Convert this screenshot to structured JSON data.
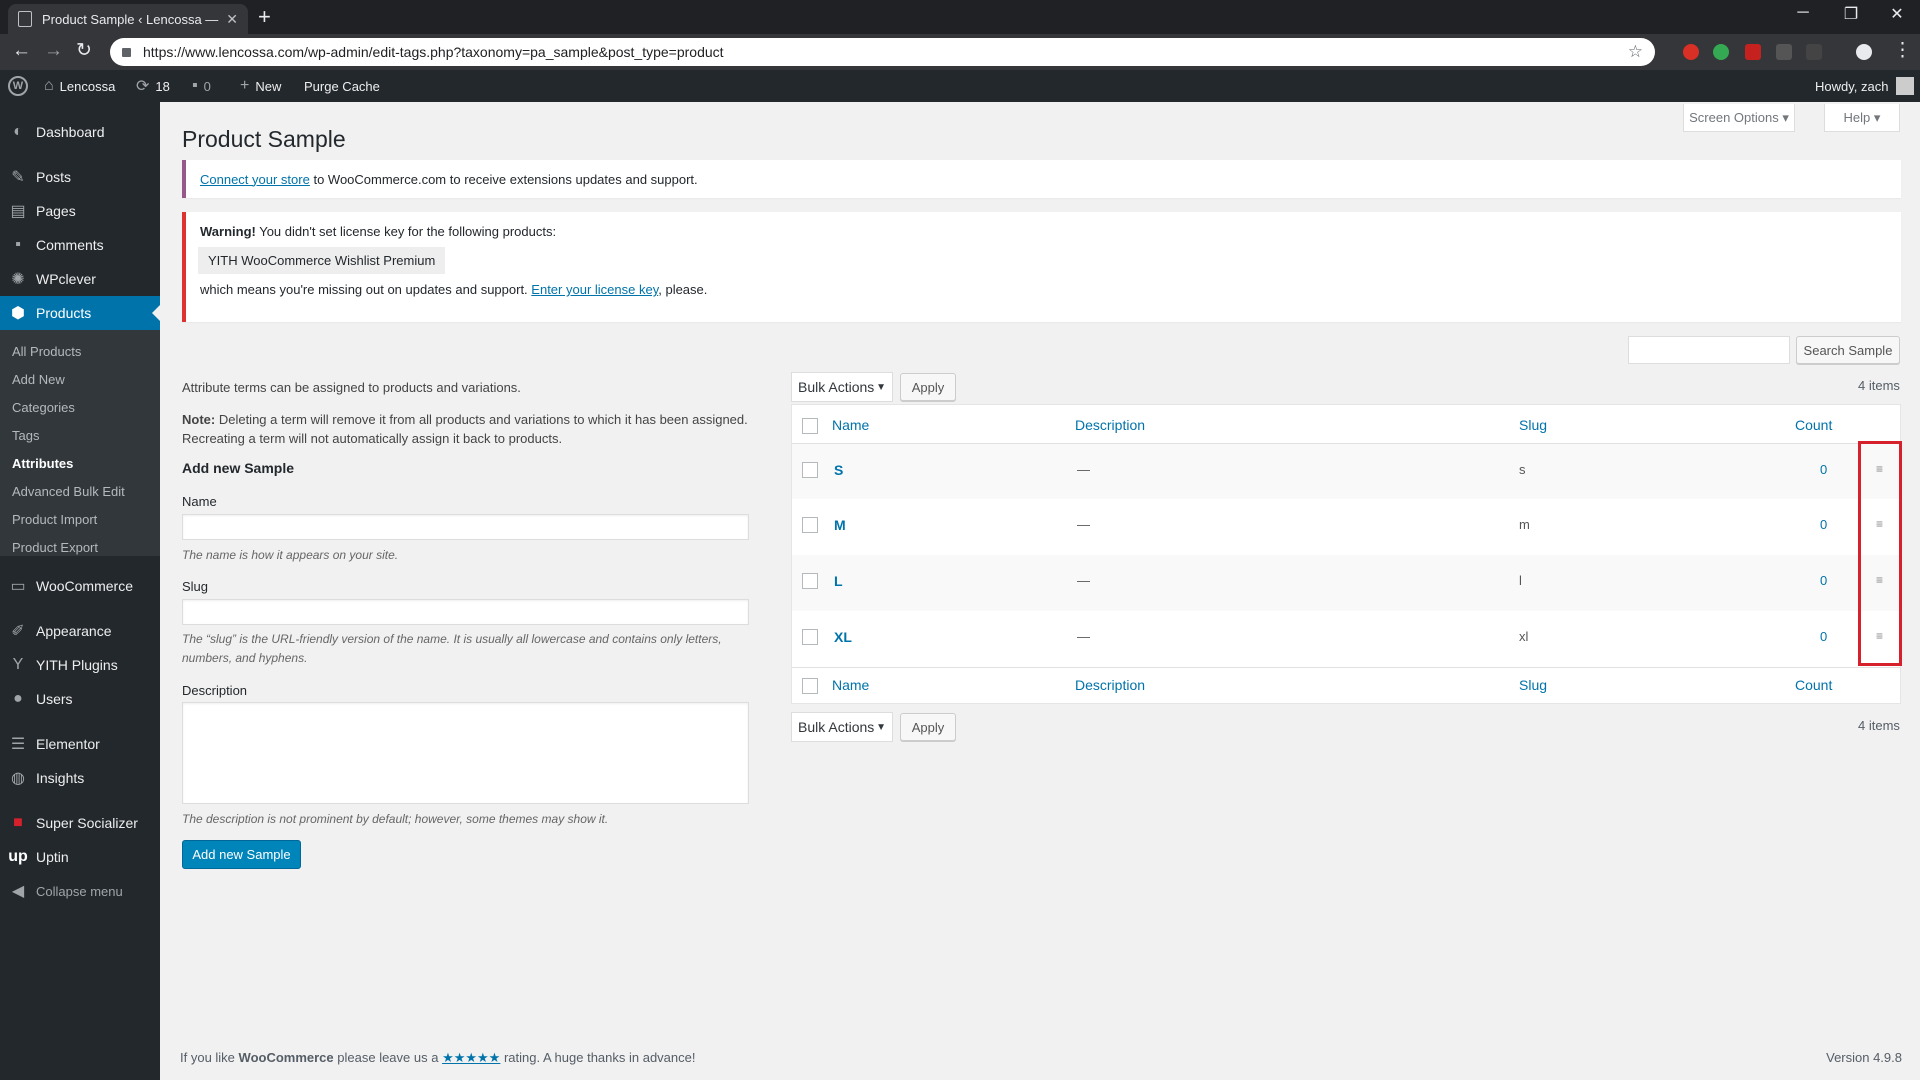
{
  "browser": {
    "tab_title": "Product Sample ‹ Lencossa — W",
    "url": "https://www.lencossa.com/wp-admin/edit-tags.php?taxonomy=pa_sample&post_type=product"
  },
  "adminbar": {
    "site_name": "Lencossa",
    "updates_count": "18",
    "comments_count": "0",
    "new_label": "New",
    "purge_label": "Purge Cache",
    "howdy": "Howdy, zach"
  },
  "sidebar": {
    "items": [
      {
        "label": "Dashboard",
        "icon": "dashboard-icon"
      },
      {
        "label": "Posts",
        "icon": "pin-icon"
      },
      {
        "label": "Pages",
        "icon": "pages-icon"
      },
      {
        "label": "Comments",
        "icon": "comment-icon"
      },
      {
        "label": "WPclever",
        "icon": "gear-icon"
      },
      {
        "label": "Products",
        "icon": "product-icon"
      },
      {
        "label": "WooCommerce",
        "icon": "woo-icon"
      },
      {
        "label": "Appearance",
        "icon": "brush-icon"
      },
      {
        "label": "YITH Plugins",
        "icon": "yith-icon"
      },
      {
        "label": "Users",
        "icon": "user-icon"
      },
      {
        "label": "Elementor",
        "icon": "elementor-icon"
      },
      {
        "label": "Insights",
        "icon": "insights-icon"
      },
      {
        "label": "Super Socializer",
        "icon": "socializer-icon"
      },
      {
        "label": "Uptin",
        "icon": "uptin-icon"
      },
      {
        "label": "Collapse menu",
        "icon": "collapse-icon"
      }
    ],
    "submenu": [
      "All Products",
      "Add New",
      "Categories",
      "Tags",
      "Attributes",
      "Advanced Bulk Edit",
      "Product Import",
      "Product Export"
    ]
  },
  "header": {
    "screen_options": "Screen Options",
    "help": "Help",
    "title": "Product Sample"
  },
  "notices": {
    "connect_link": "Connect your store",
    "connect_text": " to WooCommerce.com to receive extensions updates and support.",
    "warning_bold": "Warning!",
    "warning_text": " You didn't set license key for the following products:",
    "product": "YITH WooCommerce Wishlist Premium",
    "missing_text": "which means you're missing out on updates and support. ",
    "license_link": "Enter your license key",
    "please": ", please."
  },
  "search": {
    "button": "Search Sample"
  },
  "form": {
    "intro": "Attribute terms can be assigned to products and variations.",
    "note_bold": "Note:",
    "note_text": " Deleting a term will remove it from all products and variations to which it has been assigned. Recreating a term will not automatically assign it back to products.",
    "heading": "Add new Sample",
    "name_label": "Name",
    "name_help": "The name is how it appears on your site.",
    "slug_label": "Slug",
    "slug_help": "The “slug” is the URL-friendly version of the name. It is usually all lowercase and contains only letters, numbers, and hyphens.",
    "desc_label": "Description",
    "desc_help": "The description is not prominent by default; however, some themes may show it.",
    "submit": "Add new Sample"
  },
  "table": {
    "bulk_actions": "Bulk Actions",
    "apply": "Apply",
    "items_count": "4 items",
    "columns": {
      "name": "Name",
      "description": "Description",
      "slug": "Slug",
      "count": "Count"
    },
    "rows": [
      {
        "name": "S",
        "description": "—",
        "slug": "s",
        "count": "0"
      },
      {
        "name": "M",
        "description": "—",
        "slug": "m",
        "count": "0"
      },
      {
        "name": "L",
        "description": "—",
        "slug": "l",
        "count": "0"
      },
      {
        "name": "XL",
        "description": "—",
        "slug": "xl",
        "count": "0"
      }
    ]
  },
  "footer": {
    "text_pre": "If you like ",
    "brand": "WooCommerce",
    "text_mid": " please leave us a ",
    "stars": "★★★★★",
    "text_post": " rating. A huge thanks in advance!",
    "version": "Version 4.9.8"
  },
  "colors": {
    "accent": "#0073aa",
    "highlight": "#d6212d",
    "sidebar": "#23282d"
  }
}
